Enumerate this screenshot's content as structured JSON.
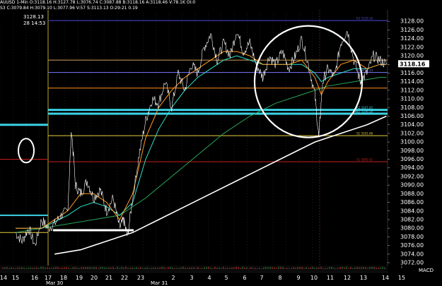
{
  "header": {
    "line1": "AUUSD  1-Min  O:3118.16  H:3127.78  L:3076.74  C:3087.88  B:3118.16  A:3118.46  V:78.1K  OI:0",
    "line2": "S3  C:3079.84  H:3079.10  L:3077.96  V:57  S:3113.13  O:29:21  0.19"
  },
  "cursor": {
    "price": "3128.13",
    "time": "28 14:53"
  },
  "chart_data": {
    "type": "line",
    "instrument": "AUUSD 1-Min",
    "ylim": [
      3072,
      3130
    ],
    "y_ticks": [
      3128,
      3126,
      3124,
      3122,
      3120,
      3118,
      3116,
      3114,
      3112,
      3110,
      3108,
      3106,
      3104,
      3102,
      3100,
      3098,
      3096,
      3094,
      3092,
      3090,
      3088,
      3086,
      3084,
      3082,
      3080,
      3078,
      3076,
      3074,
      3072
    ],
    "y_tick_labels": [
      "3128.00",
      "3126.00",
      "3124.00",
      "3122.00",
      "3120.00",
      "3118.00",
      "3116.00",
      "3114.00",
      "3112.00",
      "3110.00",
      "3108.00",
      "3106.00",
      "3104.00",
      "3102.00",
      "3100.00",
      "3098.00",
      "3096.00",
      "3094.00",
      "3092.00",
      "3090.00",
      "3088.00",
      "3086.00",
      "3084.00",
      "3082.00",
      "3080.00",
      "3078.00",
      "3076.00",
      "3074.00",
      "3072.00"
    ],
    "x_ticks": [
      "14",
      "15",
      "16",
      "17",
      "18",
      "19",
      "20",
      "21",
      "22",
      "23",
      "Mar 31",
      "2",
      "3",
      "4",
      "5",
      "6",
      "7",
      "8",
      "9",
      "10",
      "11",
      "12",
      "13",
      "14",
      "15"
    ],
    "x_day_labels": [
      "Mar 30",
      "Mar 31"
    ],
    "current_price": "3118.16",
    "price_series": [
      [
        0,
        3079
      ],
      [
        0.5,
        3077
      ],
      [
        1,
        3080
      ],
      [
        1.5,
        3076
      ],
      [
        2,
        3082
      ],
      [
        2.5,
        3080
      ],
      [
        3,
        3081
      ],
      [
        3.5,
        3083
      ],
      [
        4,
        3084
      ],
      [
        4.3,
        3103
      ],
      [
        4.6,
        3090
      ],
      [
        5,
        3088
      ],
      [
        5.5,
        3091
      ],
      [
        6,
        3087
      ],
      [
        6.5,
        3089
      ],
      [
        7,
        3084
      ],
      [
        7.5,
        3087
      ],
      [
        8,
        3080
      ],
      [
        8.3,
        3082
      ],
      [
        8.6,
        3078
      ],
      [
        9,
        3087
      ],
      [
        9.5,
        3097
      ],
      [
        10,
        3105
      ],
      [
        10.5,
        3110
      ],
      [
        11,
        3109
      ],
      [
        11.5,
        3114
      ],
      [
        12,
        3108
      ],
      [
        12.5,
        3116
      ],
      [
        13,
        3112
      ],
      [
        13.5,
        3118
      ],
      [
        14,
        3116
      ],
      [
        14.5,
        3122
      ],
      [
        15,
        3125
      ],
      [
        15.5,
        3119
      ],
      [
        16,
        3123
      ],
      [
        16.5,
        3120
      ],
      [
        17,
        3126
      ],
      [
        17.5,
        3121
      ],
      [
        18,
        3123
      ],
      [
        18.5,
        3118
      ],
      [
        19,
        3115
      ],
      [
        19.5,
        3120
      ],
      [
        20,
        3118
      ],
      [
        20.5,
        3121
      ],
      [
        21,
        3117
      ],
      [
        21.5,
        3120
      ],
      [
        22,
        3124
      ],
      [
        22.5,
        3118
      ],
      [
        23,
        3111
      ],
      [
        23.3,
        3101
      ],
      [
        23.6,
        3114
      ],
      [
        24,
        3117
      ],
      [
        24.5,
        3115
      ],
      [
        25,
        3123
      ],
      [
        25.5,
        3126
      ],
      [
        26,
        3119
      ],
      [
        26.5,
        3114
      ],
      [
        27,
        3116
      ],
      [
        27.5,
        3120
      ],
      [
        28,
        3119
      ],
      [
        28.5,
        3118
      ]
    ],
    "ma_fast": [
      [
        0,
        3080
      ],
      [
        2,
        3080
      ],
      [
        4,
        3084
      ],
      [
        5,
        3088
      ],
      [
        6,
        3088
      ],
      [
        7,
        3086
      ],
      [
        8,
        3082
      ],
      [
        9,
        3088
      ],
      [
        10,
        3101
      ],
      [
        11,
        3108
      ],
      [
        12,
        3112
      ],
      [
        13,
        3115
      ],
      [
        14,
        3117
      ],
      [
        15,
        3119
      ],
      [
        16,
        3121
      ],
      [
        17,
        3121
      ],
      [
        18,
        3120
      ],
      [
        19,
        3118
      ],
      [
        20,
        3118
      ],
      [
        21,
        3118
      ],
      [
        22,
        3119
      ],
      [
        23,
        3115
      ],
      [
        23.5,
        3111
      ],
      [
        24,
        3114
      ],
      [
        25,
        3118
      ],
      [
        26,
        3119
      ],
      [
        27,
        3117
      ],
      [
        28,
        3118
      ],
      [
        28.5,
        3118
      ]
    ],
    "ma_mid": [
      [
        0,
        3080
      ],
      [
        2,
        3080
      ],
      [
        4,
        3083
      ],
      [
        5,
        3085
      ],
      [
        6,
        3086
      ],
      [
        7,
        3085
      ],
      [
        8,
        3083
      ],
      [
        9,
        3086
      ],
      [
        10,
        3096
      ],
      [
        11,
        3103
      ],
      [
        12,
        3108
      ],
      [
        13,
        3112
      ],
      [
        14,
        3115
      ],
      [
        15,
        3117
      ],
      [
        16,
        3119
      ],
      [
        17,
        3120
      ],
      [
        18,
        3119
      ],
      [
        19,
        3118
      ],
      [
        20,
        3118
      ],
      [
        21,
        3118
      ],
      [
        22,
        3118
      ],
      [
        23,
        3116
      ],
      [
        23.5,
        3114
      ],
      [
        24,
        3115
      ],
      [
        25,
        3116
      ],
      [
        26,
        3117
      ],
      [
        27,
        3117
      ],
      [
        28,
        3118
      ],
      [
        28.5,
        3118
      ]
    ],
    "ma_slow": [
      [
        0,
        3079
      ],
      [
        2,
        3080
      ],
      [
        4,
        3081
      ],
      [
        6,
        3082
      ],
      [
        8,
        3083
      ],
      [
        10,
        3087
      ],
      [
        12,
        3092
      ],
      [
        14,
        3097
      ],
      [
        16,
        3102
      ],
      [
        18,
        3106
      ],
      [
        20,
        3109
      ],
      [
        22,
        3111
      ],
      [
        24,
        3113
      ],
      [
        26,
        3114
      ],
      [
        28,
        3115
      ],
      [
        28.5,
        3115
      ]
    ],
    "ma_long": [
      [
        3,
        3074
      ],
      [
        5,
        3075
      ],
      [
        7,
        3077
      ],
      [
        9,
        3079
      ],
      [
        11,
        3082
      ],
      [
        13,
        3085
      ],
      [
        15,
        3088
      ],
      [
        17,
        3091
      ],
      [
        19,
        3094
      ],
      [
        21,
        3097
      ],
      [
        23,
        3100
      ],
      [
        25,
        3102
      ],
      [
        27,
        3104
      ],
      [
        28.5,
        3106
      ]
    ],
    "levels": [
      {
        "label": "R3",
        "value": 3128.18,
        "text": "R3  3128.18",
        "color": "#4a4adc"
      },
      {
        "label": "",
        "value": 3119,
        "text": "",
        "color": "#d2a05a"
      },
      {
        "label": "R1",
        "value": 3116.13,
        "text": "R1  3116.13",
        "color": "#7878ff"
      },
      {
        "label": "",
        "value": 3112.5,
        "text": "",
        "color": "#ff8c1e"
      },
      {
        "label": "R2",
        "value": 3107.45,
        "text": "R2  3107.45",
        "color": "#3cd2e6"
      },
      {
        "label": "MID",
        "value": 3106.58,
        "text": "MID  3106.58",
        "color": "#3cd2e6"
      },
      {
        "label": "S1",
        "value": 3101.48,
        "text": "S1  3101.48",
        "color": "#e6d23c"
      },
      {
        "label": "S1",
        "value": 3095.42,
        "text": "S1  3095.42",
        "color": "#c81e1e"
      }
    ],
    "annotations": {
      "circle_small": {
        "center": [
          -8.9,
          3098
        ],
        "note": "white ellipse"
      },
      "circle_large": {
        "center": [
          23.3,
          3114
        ],
        "note": "white circle"
      },
      "underline": {
        "from": [
          4.4,
          3080
        ],
        "to": [
          8.8,
          3080
        ]
      }
    },
    "macd_label": "MACD"
  },
  "colors": {
    "price": "#ffffff",
    "ma_fast": "#ff9a1e",
    "ma_mid": "#2ee0c8",
    "ma_slow": "#2aa65a",
    "ma_long": "#ffffff",
    "current_price_box": "#ffffff",
    "grid": "#333333"
  }
}
